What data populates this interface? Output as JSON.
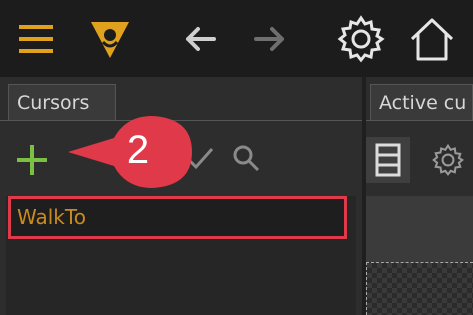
{
  "icons": {
    "menu": "hamburger-menu-icon",
    "logo": "app-logo-icon",
    "back": "arrow-left-icon",
    "forward": "arrow-right-icon",
    "settings": "gear-icon",
    "home": "home-icon",
    "add": "plus-icon",
    "confirm": "checkmark-icon",
    "search": "search-icon",
    "filmstrip": "film-icon",
    "preview_settings": "gear-icon"
  },
  "colors": {
    "accent": "#e0a21e",
    "add_green": "#7bc043",
    "highlight": "#e0394a",
    "item_text": "#c98a1e"
  },
  "left_panel": {
    "tab_label": "Cursors",
    "items": [
      {
        "label": "WalkTo"
      }
    ]
  },
  "right_panel": {
    "tab_label": "Active cu"
  },
  "callout": {
    "number": "2"
  }
}
